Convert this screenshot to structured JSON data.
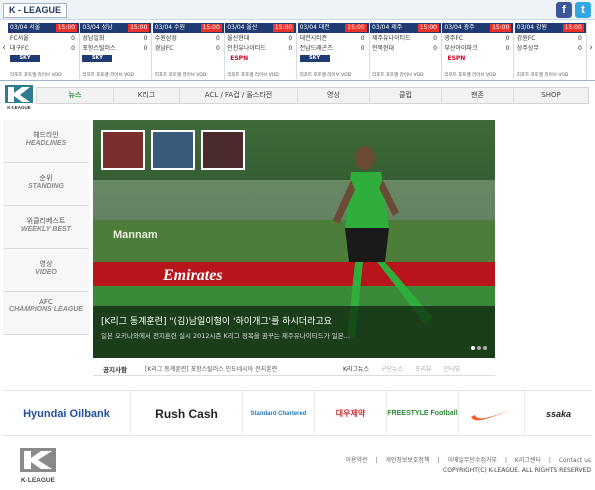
{
  "header": {
    "brand": "K - LEAGUE",
    "facebook_icon": "f",
    "twitter_icon": "t"
  },
  "scores": [
    {
      "date": "03/04 서울",
      "time": "15:00",
      "home": "FC서울",
      "home_score": "0",
      "away": "대구FC",
      "away_score": "0",
      "broadcaster": "SKY SPORTS 2",
      "links": "리포트 포토앨 라이브 VOD"
    },
    {
      "date": "03/04 성남",
      "time": "15:00",
      "home": "성남일화",
      "home_score": "0",
      "away": "포항스틸러스",
      "away_score": "0",
      "broadcaster": "SKY SPORTS 2",
      "links": "리포트 포토앨 라이브 VOD"
    },
    {
      "date": "03/04 수원",
      "time": "15:00",
      "home": "수원삼성",
      "home_score": "0",
      "away": "경남FC",
      "away_score": "0",
      "broadcaster": "",
      "links": "리포트 포토앨 라이브 VOD"
    },
    {
      "date": "03/04 울산",
      "time": "15:00",
      "home": "울산현대",
      "home_score": "0",
      "away": "인천유나이티드",
      "away_score": "0",
      "broadcaster": "ESPN",
      "links": "리포트 포토앨 라이브 VOD"
    },
    {
      "date": "03/04 대전",
      "time": "15:00",
      "home": "대전시티즌",
      "home_score": "0",
      "away": "전남드래곤즈",
      "away_score": "0",
      "broadcaster": "SKY SPORTS 2",
      "links": "리포트 포토앨 라이브 VOD"
    },
    {
      "date": "03/04 제주",
      "time": "15:00",
      "home": "제주유나이티드",
      "home_score": "0",
      "away": "전북현대",
      "away_score": "0",
      "broadcaster": "",
      "links": "리포트 포토앨 라이브 VOD"
    },
    {
      "date": "03/04 광주",
      "time": "15:00",
      "home": "광주FC",
      "home_score": "0",
      "away": "부산아이파크",
      "away_score": "0",
      "broadcaster": "ESPN",
      "links": "리포트 포토앨 라이브 VOD"
    },
    {
      "date": "03/04 강원",
      "time": "15:00",
      "home": "강원FC",
      "home_score": "0",
      "away": "상주상무",
      "away_score": "0",
      "broadcaster": "",
      "links": "리포트 포토앨 라이브 VOD"
    }
  ],
  "nav": {
    "logo_text": "K-LEAGUE",
    "items": [
      "뉴스",
      "K리그",
      "ACL / FA컵 / 올스타전",
      "영상",
      "클럽",
      "팬존",
      "SHOP"
    ]
  },
  "left_menu": [
    {
      "ko": "헤드라인",
      "en": "HEADLINES"
    },
    {
      "ko": "순위",
      "en": "STANDING"
    },
    {
      "ko": "위클리베스트",
      "en": "WEEKLY BEST"
    },
    {
      "ko": "영상",
      "en": "VIDEO"
    },
    {
      "ko": "AFC",
      "en": "CHAMPIONS LEAGUE"
    }
  ],
  "hero": {
    "title": "[K리그 동계훈련] \"(김)남일이형이 '하이개그'를 하시더라고요",
    "subtitle": "일본 오키나와에서 전지훈련 실시 2012시즌 K리그 정복을 꿈꾸는 제주유나이티드가 일본...",
    "banner_text": "Emirates",
    "stadium_text": "Mannam",
    "dot_count": 3
  },
  "notice": {
    "label": "공지사항",
    "text": "[K리그 동계훈련] 포항스틸러스 인도네시아 전지훈련",
    "tabs": [
      "K리그뉴스",
      "구단뉴스",
      "프리뷰",
      "인터뷰"
    ]
  },
  "sponsors": [
    "Hyundai Oilbank",
    "Rush Cash",
    "Standard Chartered",
    "대우제약",
    "FREESTYLE Football",
    "nike swoosh",
    "ssaka"
  ],
  "footer": {
    "logo_text": "K·LEAGUE",
    "links": [
      "이용약관",
      "|",
      "개인정보보호정책",
      "|",
      "이메일무단수집거부",
      "|",
      "K리그센터",
      "|",
      "Contact us"
    ],
    "copyright": "COPYRIGHT(C) K-LEAGUE. ALL RIGHTS RESERVED"
  },
  "colors": {
    "accent": "#2e8b3a",
    "navy": "#1f3b73",
    "time_red": "#e8322b"
  }
}
